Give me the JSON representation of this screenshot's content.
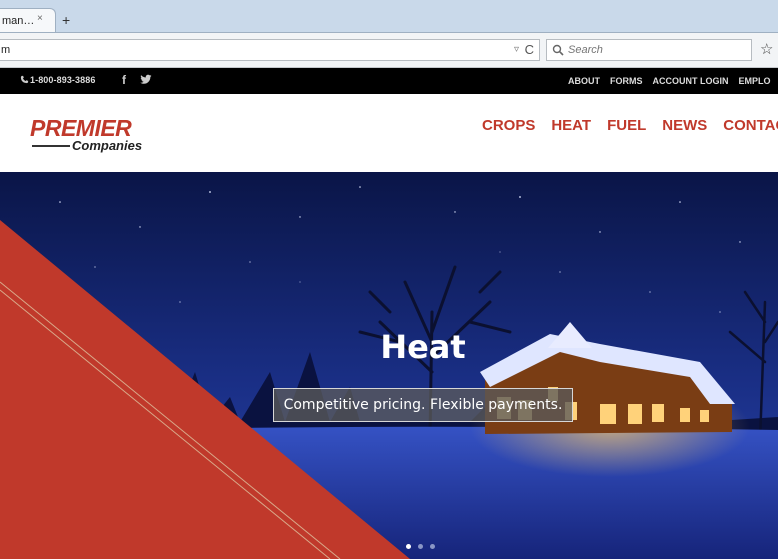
{
  "browser": {
    "tab": {
      "label": "man…",
      "close": "×"
    },
    "new_tab": "+",
    "url": "m",
    "url_dropdown": "▿",
    "url_reload": "C",
    "search_placeholder": "Search",
    "bookmark_star": "☆"
  },
  "topbar": {
    "phone": "1-800-893-3886",
    "social": {
      "facebook": "f",
      "twitter": "twitter-icon"
    },
    "links": [
      "ABOUT",
      "FORMS",
      "ACCOUNT LOGIN",
      "EMPLO"
    ]
  },
  "header": {
    "logo": {
      "word": "PREMIER",
      "sub": "Companies"
    },
    "nav": [
      "CROPS",
      "HEAT",
      "FUEL",
      "NEWS",
      "CONTAC"
    ]
  },
  "hero": {
    "title": "Heat",
    "caption": "Competitive pricing. Flexible payments.",
    "slides": [
      {
        "active": true
      },
      {
        "active": false
      },
      {
        "active": false
      }
    ]
  },
  "colors": {
    "brand_red": "#c0392b",
    "topbar": "#000000",
    "night_sky": "#0e1a52"
  }
}
